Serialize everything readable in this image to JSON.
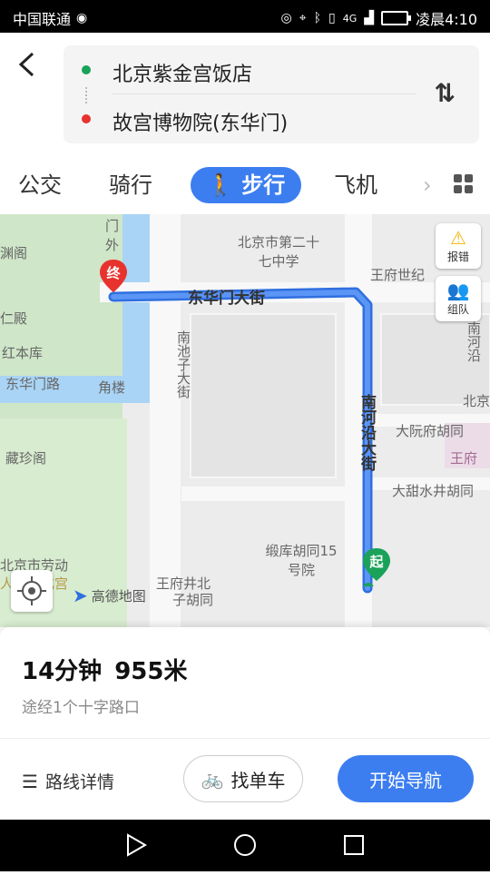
{
  "status_bar": {
    "carrier": "中国联通",
    "time": "凌晨4:10",
    "network": "4G"
  },
  "route": {
    "origin": "北京紫金宫饭店",
    "destination": "故宫博物院(东华门)"
  },
  "tabs": [
    {
      "label": "公交"
    },
    {
      "label": "骑行"
    },
    {
      "label": "步行",
      "active": true
    },
    {
      "label": "飞机"
    }
  ],
  "map": {
    "street_east_west": "东华门大街",
    "street_north_south": "南河沿大街",
    "street_nanchizi": "南池子大街",
    "end_marker": "终",
    "start_marker": "起",
    "labels": {
      "school": "北京市第二十七中学",
      "wangfu": "王府世纪",
      "nanhe": "南河沿",
      "beijing": "北京",
      "dayuan": "大阮府胡同",
      "wangfu2": "王府",
      "datian": "大甜水井胡同",
      "qukulu": "缎库胡同15号院",
      "wangfujing": "王府井北",
      "zihutong": "子胡同",
      "menwai": "门外",
      "yuange": "渊阁",
      "renmian": "仁殿",
      "hongbenku": "红本库",
      "donghuamenlu": "东华门路",
      "jiaolou": "角楼",
      "cangzhen": "藏珍阁",
      "laodong": "北京市劳动",
      "wenhuagong": "人民文化宫",
      "nanchi": "南池"
    },
    "report_btn": "报错",
    "team_btn": "组队",
    "logo_text": "高德地图"
  },
  "summary": {
    "duration": "14分钟",
    "distance": "955米",
    "via": "途经1个十字路口"
  },
  "actions": {
    "details": "路线详情",
    "find_bike": "找单车",
    "start_nav": "开始导航"
  },
  "colors": {
    "accent": "#3c7ef0",
    "start": "#1aa25a",
    "end": "#e8322e"
  }
}
